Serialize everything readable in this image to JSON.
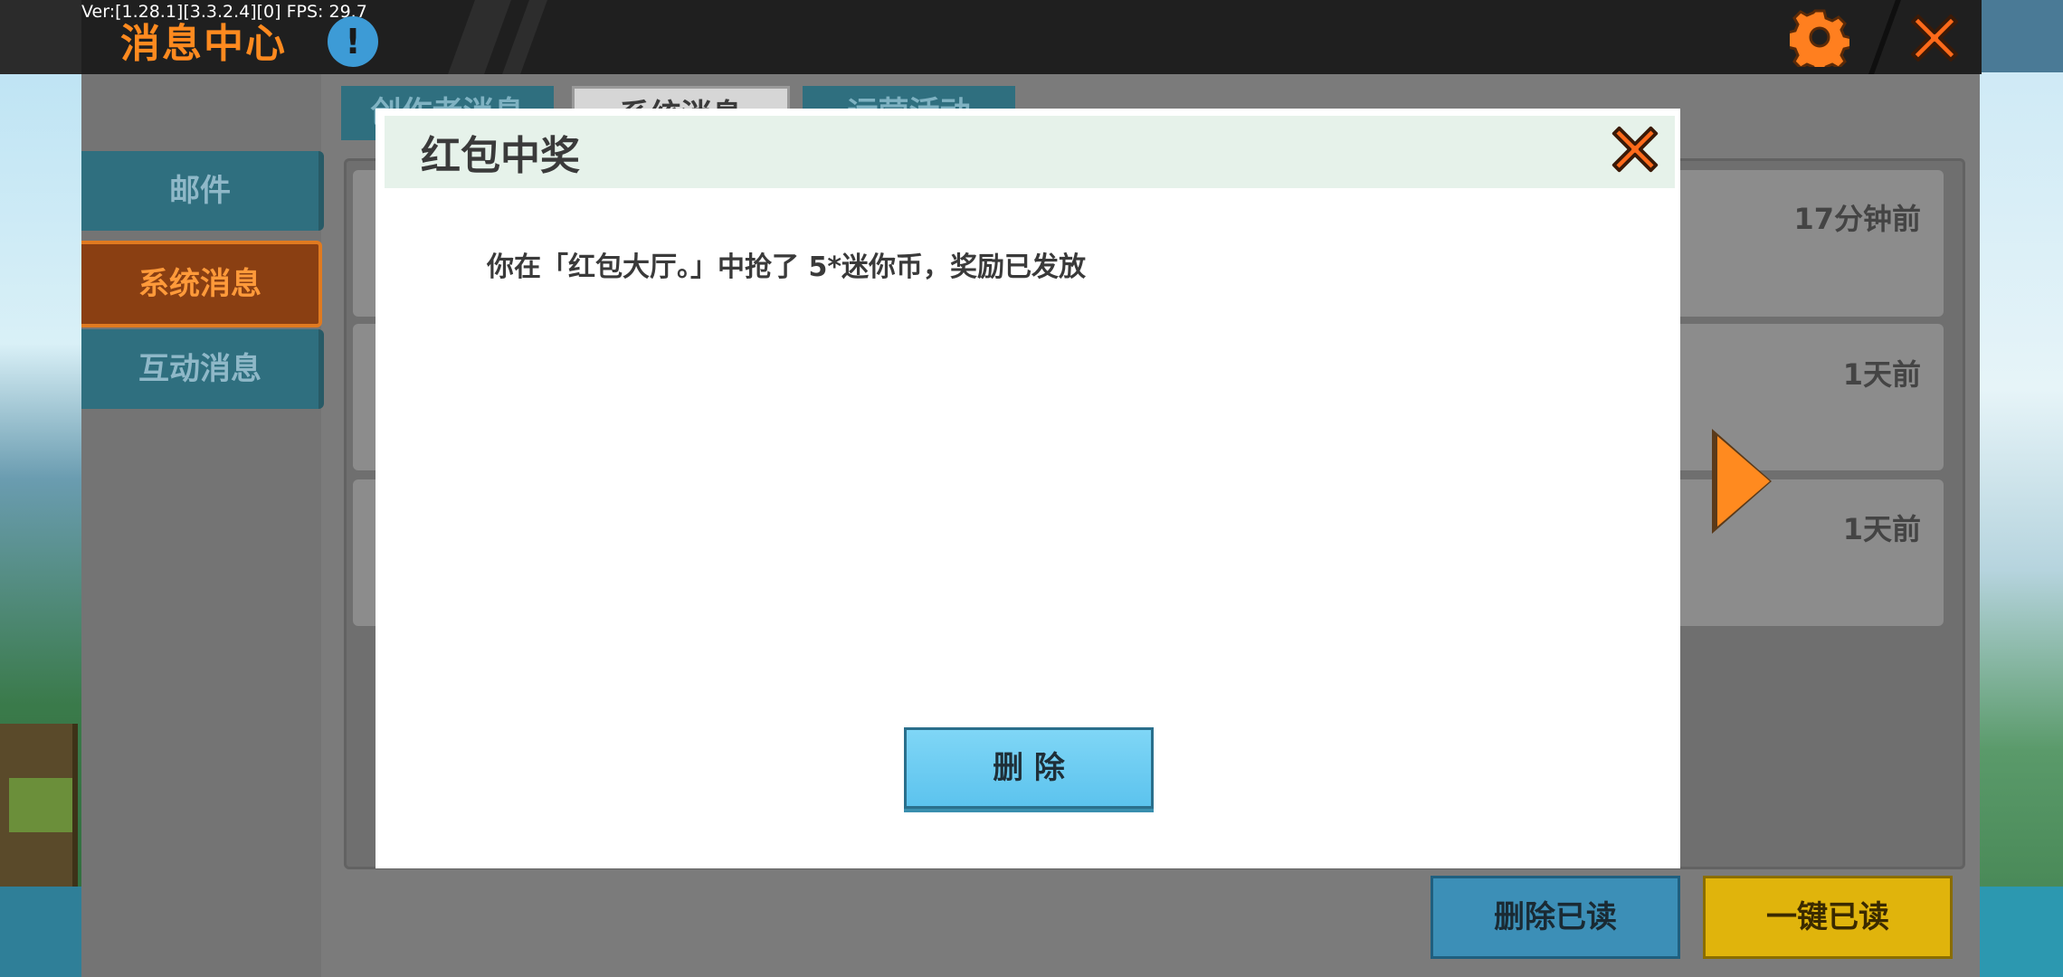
{
  "header": {
    "title": "消息中心",
    "version_text": "Ver:[1.28.1][3.3.2.4][0] FPS: 29.7",
    "info_icon": "!"
  },
  "sidebar": {
    "items": [
      {
        "label": "邮件",
        "active": false
      },
      {
        "label": "系统消息",
        "active": true
      },
      {
        "label": "互动消息",
        "active": false
      }
    ]
  },
  "tabs": [
    {
      "label": "创作者消息"
    },
    {
      "label": "系统消息"
    },
    {
      "label": "运营活动"
    }
  ],
  "messages": [
    {
      "time": "17分钟前"
    },
    {
      "time": "1天前"
    },
    {
      "time": "1天前"
    }
  ],
  "footer": {
    "delete_read_label": "删除已读",
    "mark_all_read_label": "一键已读"
  },
  "modal": {
    "title": "红包中奖",
    "message": "你在「红包大厅。」中抢了 5*迷你币，奖励已发放",
    "delete_label": "删 除"
  },
  "colors": {
    "accent_orange": "#ff8a1f",
    "topbar": "#1f1f1f",
    "panel": "#7b7b7b",
    "button_blue": "#5cc3ee",
    "button_yellow": "#e0b40c"
  }
}
